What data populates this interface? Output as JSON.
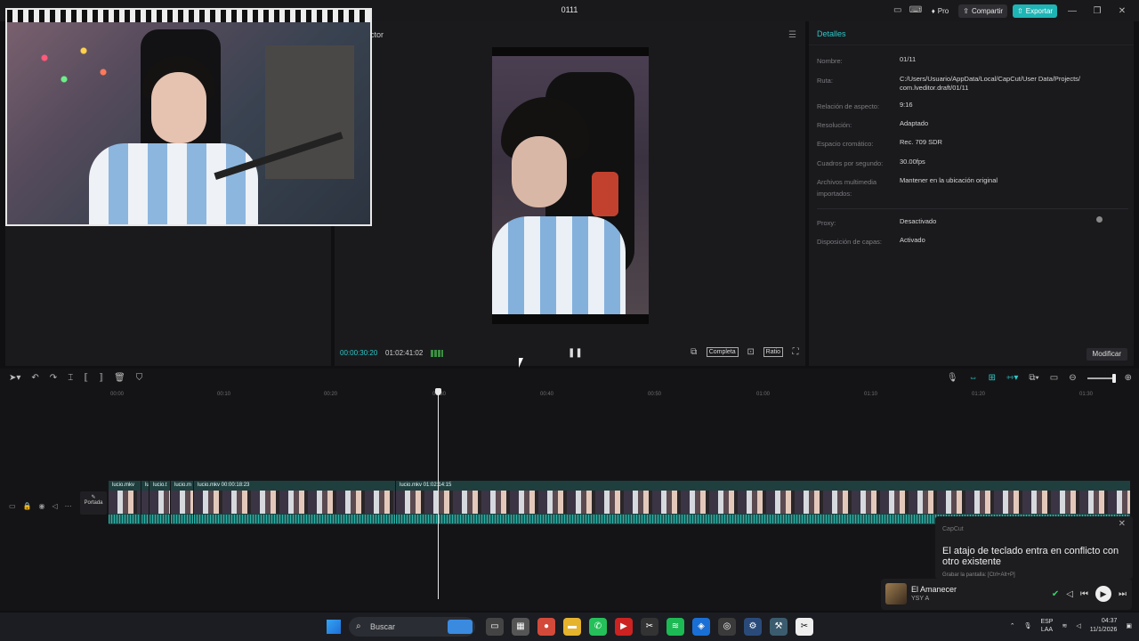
{
  "window": {
    "title": "0111"
  },
  "topbar": {
    "pro": "Pro",
    "share": "Compartir",
    "export": "Exportar"
  },
  "player": {
    "label": "ductor",
    "current_time": "00:00:30:20",
    "total_time": "01:02:41:02",
    "ratio_button": "Completa",
    "quality_button": "Ratio"
  },
  "details": {
    "heading": "Detalles",
    "fields": [
      {
        "key": "Nombre:",
        "value": "01/11"
      },
      {
        "key": "Ruta:",
        "value": "C:/Users/Usuario/AppData/Local/CapCut/User Data/Projects/ com.lveditor.draft/01/11"
      },
      {
        "key": "Relación de aspecto:",
        "value": "9:16"
      },
      {
        "key": "Resolución:",
        "value": "Adaptado"
      },
      {
        "key": "Espacio cromático:",
        "value": "Rec. 709 SDR"
      },
      {
        "key": "Cuadros por segundo:",
        "value": "30.00fps"
      },
      {
        "key": "Archivos multimedia importados:",
        "value": "Mantener en la ubicación original"
      },
      {
        "key": "Proxy:",
        "value": "Desactivado"
      },
      {
        "key": "Disposición de capas:",
        "value": "Activado"
      }
    ],
    "modify_button": "Modificar"
  },
  "timeline": {
    "ruler": [
      "00:00",
      "00:10",
      "00:20",
      "00:30",
      "00:40",
      "00:50",
      "01:00",
      "01:10",
      "01:20",
      "01:30"
    ],
    "cover_label": "Portada",
    "clips": [
      {
        "label": "lucio.mkv"
      },
      {
        "label": "lu"
      },
      {
        "label": "lucio.t"
      },
      {
        "label": "lucio.m"
      },
      {
        "label": "lucio.mkv  00:00:18:23"
      },
      {
        "label": "lucio.mkv  01:02:14:15"
      }
    ]
  },
  "notification": {
    "app": "CapCut",
    "message": "El atajo de teclado entra en conflicto con otro existente",
    "sub": "Grabar la pantalla: [Ctrl+Alt+P]"
  },
  "media": {
    "song": "El Amanecer",
    "artist": "YSY A"
  },
  "taskbar": {
    "search": "Buscar",
    "lang_top": "ESP",
    "lang_bottom": "LAA",
    "time": "04:37",
    "date": "11/1/2026"
  }
}
